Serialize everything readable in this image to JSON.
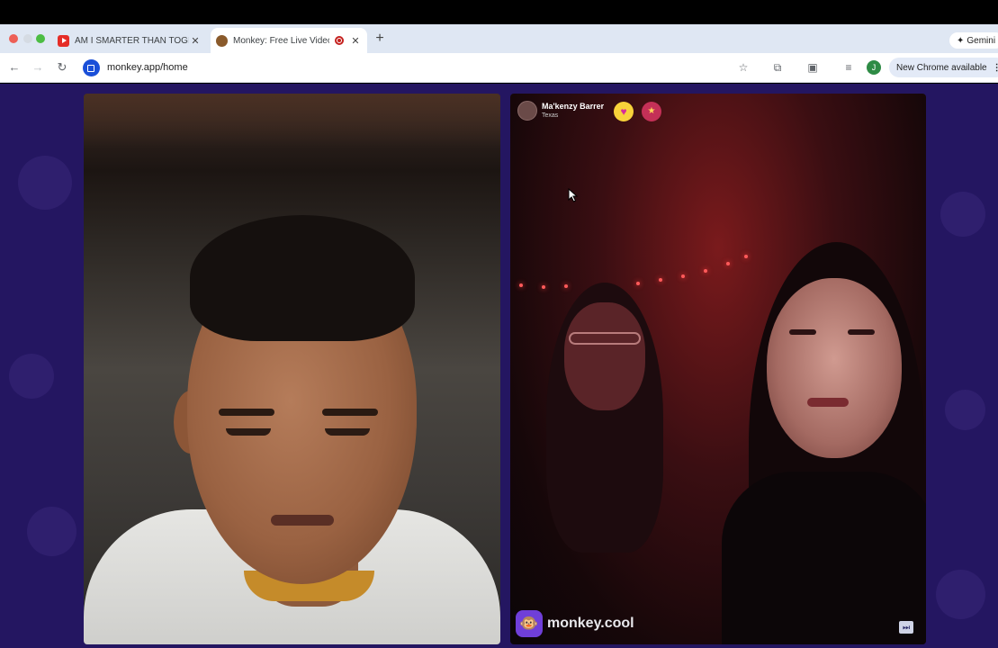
{
  "browser": {
    "tabs": [
      {
        "title": "AM I SMARTER THAN TOGI?",
        "icon": "youtube-icon",
        "active": false
      },
      {
        "title": "Monkey: Free Live Video C",
        "icon": "monkey-icon",
        "active": true
      }
    ],
    "new_tab_symbol": "+",
    "gemini_label": "Gemini",
    "url": "monkey.app/home",
    "profile_initial": "J",
    "update_label": "New Chrome available",
    "update_menu": "⋮",
    "colors": {
      "tab_strip": "#dfe7f3",
      "content_bg": "#241661"
    }
  },
  "call": {
    "remote_user": {
      "name": "Ma'kenzy Barrer",
      "location": "Texas"
    },
    "badges": [
      "heart-badge-icon",
      "gift-badge-icon"
    ],
    "watermark": "monkey.cool",
    "skip_icon": "fast-forward-icon"
  }
}
